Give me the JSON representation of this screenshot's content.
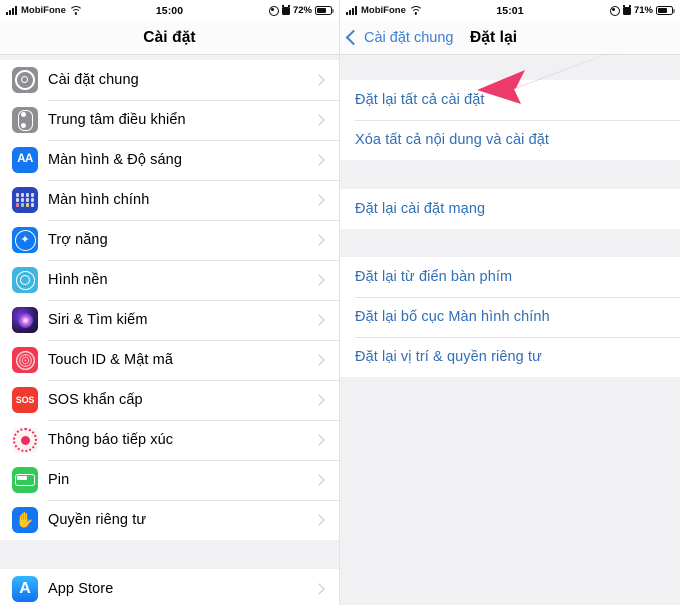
{
  "left_panel": {
    "status_bar": {
      "carrier": "MobiFone",
      "time": "15:00",
      "battery_percent": "72%",
      "signal_icon": "signal-bars-icon",
      "wifi_icon": "wifi-icon",
      "location_icon": "location-services-icon",
      "alarm_icon": "alarm-clock-icon",
      "battery_icon": "battery-icon"
    },
    "nav": {
      "title": "Cài đặt"
    },
    "groups": [
      {
        "rows": [
          {
            "label": "Cài đặt chung",
            "icon": "gear-icon",
            "icon_class": "ic-gear",
            "glyph": ""
          },
          {
            "label": "Trung tâm điều khiển",
            "icon": "control-center-icon",
            "icon_class": "ic-cc",
            "glyph": ""
          },
          {
            "label": "Màn hình & Độ sáng",
            "icon": "display-brightness-icon",
            "icon_class": "ic-aa",
            "glyph": "AA"
          },
          {
            "label": "Màn hình chính",
            "icon": "home-screen-icon",
            "icon_class": "ic-home",
            "glyph": ""
          },
          {
            "label": "Trợ năng",
            "icon": "accessibility-icon",
            "icon_class": "ic-acc",
            "glyph": "✦"
          },
          {
            "label": "Hình nền",
            "icon": "wallpaper-icon",
            "icon_class": "ic-wall",
            "glyph": ""
          },
          {
            "label": "Siri & Tìm kiếm",
            "icon": "siri-icon",
            "icon_class": "ic-siri",
            "glyph": ""
          },
          {
            "label": "Touch ID & Mật mã",
            "icon": "touch-id-icon",
            "icon_class": "ic-touch",
            "glyph": ""
          },
          {
            "label": "SOS khẩn cấp",
            "icon": "sos-icon",
            "icon_class": "ic-sos",
            "glyph": "SOS"
          },
          {
            "label": "Thông báo tiếp xúc",
            "icon": "exposure-notification-icon",
            "icon_class": "ic-expo",
            "glyph": ""
          },
          {
            "label": "Pin",
            "icon": "battery-settings-icon",
            "icon_class": "ic-batt",
            "glyph": ""
          },
          {
            "label": "Quyền riêng tư",
            "icon": "privacy-hand-icon",
            "icon_class": "ic-priv",
            "glyph": "✋"
          }
        ]
      },
      {
        "rows": [
          {
            "label": "App Store",
            "icon": "app-store-icon",
            "icon_class": "ic-appstore",
            "glyph": "A"
          }
        ]
      }
    ]
  },
  "right_panel": {
    "status_bar": {
      "carrier": "MobiFone",
      "time": "15:01",
      "battery_percent": "71%",
      "signal_icon": "signal-bars-icon",
      "wifi_icon": "wifi-icon",
      "location_icon": "location-services-icon",
      "alarm_icon": "alarm-clock-icon",
      "battery_icon": "battery-icon"
    },
    "nav": {
      "back_label": "Cài đặt chung",
      "title": "Đặt lại",
      "back_icon": "chevron-left-icon"
    },
    "groups": [
      {
        "rows": [
          {
            "label": "Đặt lại tất cả cài đặt"
          },
          {
            "label": "Xóa tất cả nội dung và cài đặt"
          }
        ]
      },
      {
        "rows": [
          {
            "label": "Đặt lại cài đặt mạng"
          }
        ]
      },
      {
        "rows": [
          {
            "label": "Đặt lại từ điển bàn phím"
          },
          {
            "label": "Đặt lại bố cục Màn hình chính"
          },
          {
            "label": "Đặt lại vị trí & quyền riêng tư"
          }
        ]
      }
    ],
    "annotation": {
      "type": "arrow",
      "color": "#ec3a6b",
      "points_to": "Đặt lại tất cả cài đặt"
    }
  },
  "colors": {
    "link_blue": "#2f6fb5",
    "nav_blue": "#3b7fd4",
    "group_background": "#f1f1f4",
    "row_background": "#ffffff",
    "separator": "#e4e4e6",
    "arrow_pink": "#ec3a6b"
  }
}
